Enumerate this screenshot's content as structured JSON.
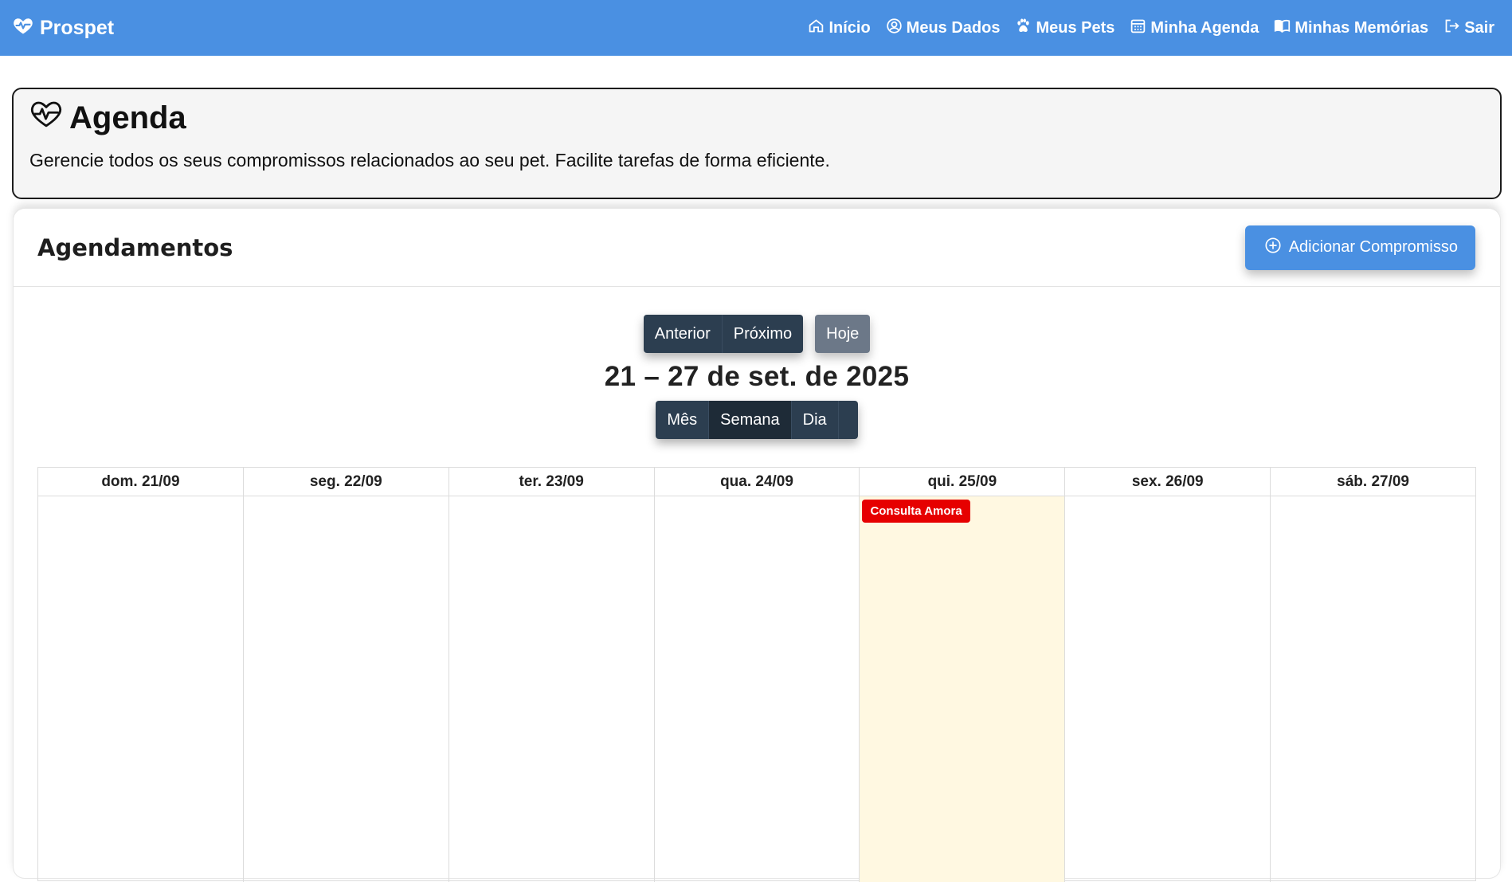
{
  "navbar": {
    "brand": "Prospet",
    "links": [
      {
        "label": "Início",
        "icon": "house-icon"
      },
      {
        "label": "Meus Dados",
        "icon": "user-circle-icon"
      },
      {
        "label": "Meus Pets",
        "icon": "paw-icon"
      },
      {
        "label": "Minha Agenda",
        "icon": "calendar-icon"
      },
      {
        "label": "Minhas Memórias",
        "icon": "book-icon"
      },
      {
        "label": "Sair",
        "icon": "logout-icon"
      }
    ]
  },
  "header": {
    "title": "Agenda",
    "subtitle": "Gerencie todos os seus compromissos relacionados ao seu pet. Facilite tarefas de forma eficiente."
  },
  "card": {
    "title": "Agendamentos",
    "add_button": "Adicionar Compromisso"
  },
  "toolbar": {
    "prev": "Anterior",
    "next": "Próximo",
    "today": "Hoje",
    "range": "21 – 27 de set. de 2025",
    "views": [
      "Mês",
      "Semana",
      "Dia"
    ],
    "active_view": "Semana"
  },
  "calendar": {
    "days": [
      "dom. 21/09",
      "seg. 22/09",
      "ter. 23/09",
      "qua. 24/09",
      "qui. 25/09",
      "sex. 26/09",
      "sáb. 27/09"
    ],
    "today_index": 4,
    "events": [
      {
        "day_index": 4,
        "title": "Consulta Amora",
        "color": "#e60000"
      }
    ]
  },
  "colors": {
    "primary": "#4a90e2",
    "dark_button": "#2c3e50",
    "today_bg": "#fff8e1",
    "event": "#e60000"
  }
}
